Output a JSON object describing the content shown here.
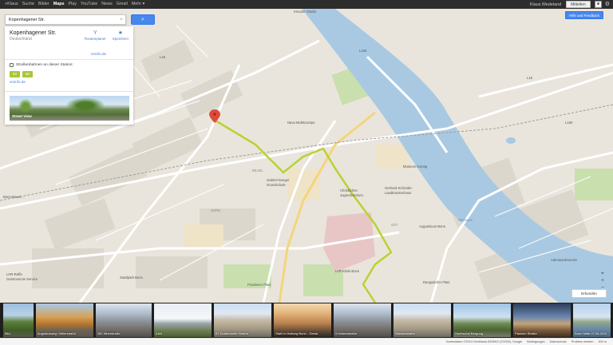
{
  "gbar": {
    "links": [
      "+Klaus",
      "Suche",
      "Bilder",
      "Maps",
      "Play",
      "YouTube",
      "News",
      "Gmail",
      "Mehr ▾"
    ],
    "active_index": 3,
    "user": "Klaus Wedeland",
    "share_label": "Mitteilen"
  },
  "search": {
    "value": "Kopenhagener Str.",
    "clear_glyph": "×",
    "button_glyph": "⌕"
  },
  "place": {
    "title": "Kopenhagener Str.",
    "subtitle": "Deutschland",
    "actions": [
      {
        "label": "Routenplaner",
        "icon": "route-icon",
        "glyph": "Y"
      },
      {
        "label": "Speichern",
        "icon": "star-icon",
        "glyph": "★"
      }
    ],
    "link": "vrsinfo.de"
  },
  "transit": {
    "heading": "Straßenbahnen an dieser Station:",
    "lines": [
      "63",
      "66"
    ],
    "link": "vrsinfo.de",
    "line_color": "#a8c832"
  },
  "streetview": {
    "label": "Street View"
  },
  "help_button": "Hilfe und Feedback",
  "zoom": {
    "plus": "+",
    "minus": "−",
    "locate": "⌖"
  },
  "layer_button": "Erkunden",
  "map_labels": {
    "top_road": "Kreuzer Straße",
    "station_left": "Bonn-Beuel ...",
    "nava": "Nava Multiscorepe",
    "dieterle": "Dieterle Straße",
    "gabriel": "Gabriel-Seeger",
    "grundschule": "Grundschule",
    "christliches": "Christliches",
    "jugend": "Jugendzentrum",
    "gerhard": "Gerhard-Schröder-",
    "landkrk": "Landkrankenhaus",
    "augusta": "Augustinum Bonn",
    "lvr": "LVR-Klinik Bonn",
    "rheinaue": "Rheinaue",
    "pfund": "Pfundsbuch",
    "posdamer": "Posdamer Platz",
    "stadtpark": "Stadtpark Bonn",
    "lebens": "LEBENSIAU",
    "li1": "LHR-Raffa",
    "li2": "Gastronomie Service",
    "dortmund": "Dortmund-Stolz",
    "rheinland": "Rheinlandhaus",
    "rueng": "Rüngsdorfer Platz",
    "gustav": "Gustav-Heinemann",
    "adenauer": "Adenauerbruecke",
    "beuel": "BEUEL",
    "nord": "NORD",
    "nordstadt": "NORDSTADT",
    "alte_schule": "Alte Schule",
    "museum": "Museum Koenig",
    "ost": "OST",
    "bahnhof": "Hauptbahnhof",
    "b9": "B9",
    "l1": "L16",
    "l2": "L16",
    "l3": "L160",
    "l4": "L160"
  },
  "photos": [
    {
      "caption": "Bild",
      "tone": "p-green"
    },
    {
      "caption": "Augustusweg / Niherstraße",
      "tone": "p-autumn"
    },
    {
      "caption": "182 Niherstraße",
      "tone": "p-street"
    },
    {
      "caption": "Aleit",
      "tone": "p-white"
    },
    {
      "caption": "87 Dottendorfer Straße",
      "tone": "p-house"
    },
    {
      "caption": "Stahl in Haltung Bonn - Gesta",
      "tone": "p-warm"
    },
    {
      "caption": "5 Heisenstraße",
      "tone": "p-street"
    },
    {
      "caption": "Wasserstraße",
      "tone": "p-house"
    },
    {
      "caption": "Hochschul Bergung",
      "tone": "p-sky"
    },
    {
      "caption": "Paulsen Straße",
      "tone": "p-night"
    },
    {
      "caption": "Bonn Mitte 07.06.2011",
      "tone": "p-river"
    }
  ],
  "footer": [
    "Kartendaten ©2013 GeoBasis-DE/BKG (©2009), Google",
    "Bedingungen",
    "Datenschutz",
    "Problem melden",
    "200 m"
  ]
}
